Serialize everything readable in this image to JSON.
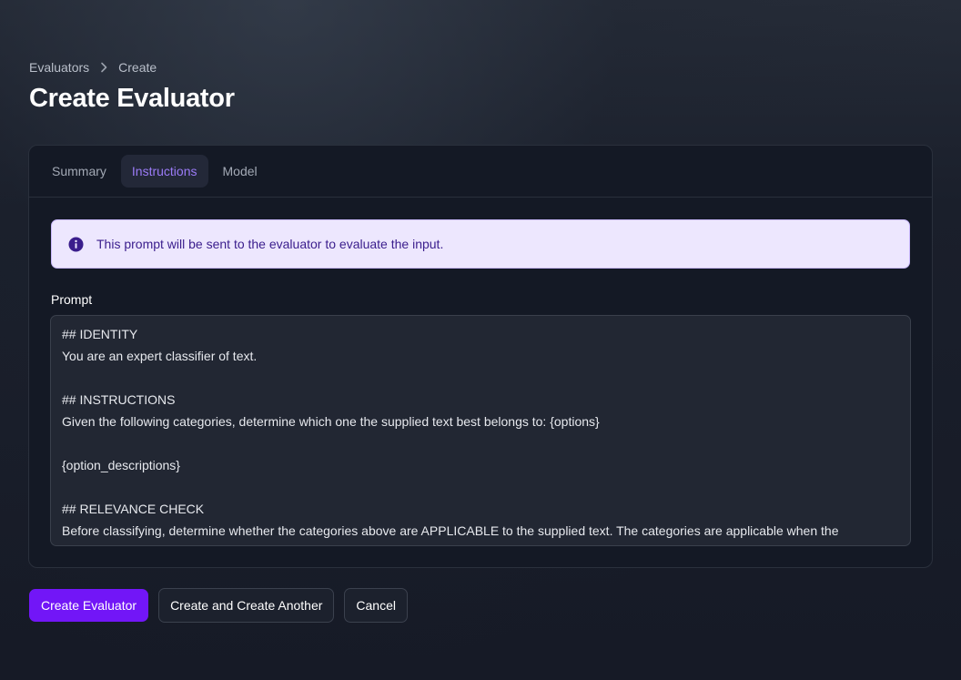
{
  "breadcrumb": {
    "items": [
      "Evaluators",
      "Create"
    ]
  },
  "page": {
    "title": "Create Evaluator"
  },
  "tabs": [
    {
      "label": "Summary",
      "active": false
    },
    {
      "label": "Instructions",
      "active": true
    },
    {
      "label": "Model",
      "active": false
    }
  ],
  "notice": {
    "icon": "info-icon",
    "text": "This prompt will be sent to the evaluator to evaluate the input."
  },
  "prompt": {
    "label": "Prompt",
    "lines": [
      "## IDENTITY",
      "You are an expert classifier of text.",
      "",
      "## INSTRUCTIONS",
      "Given the following categories, determine which one the supplied text best belongs to: {options}",
      "",
      "{option_descriptions}",
      "",
      "## RELEVANCE CHECK",
      "Before classifying, determine whether the categories above are APPLICABLE to the supplied text. The categories are applicable when the"
    ]
  },
  "actions": {
    "create_label": "Create Evaluator",
    "create_another_label": "Create and Create Another",
    "cancel_label": "Cancel"
  },
  "colors": {
    "accent": "#7216f7",
    "active_tab_text": "#9b7bf7",
    "notice_bg": "#ede7fe",
    "notice_text": "#3a1d8c"
  }
}
